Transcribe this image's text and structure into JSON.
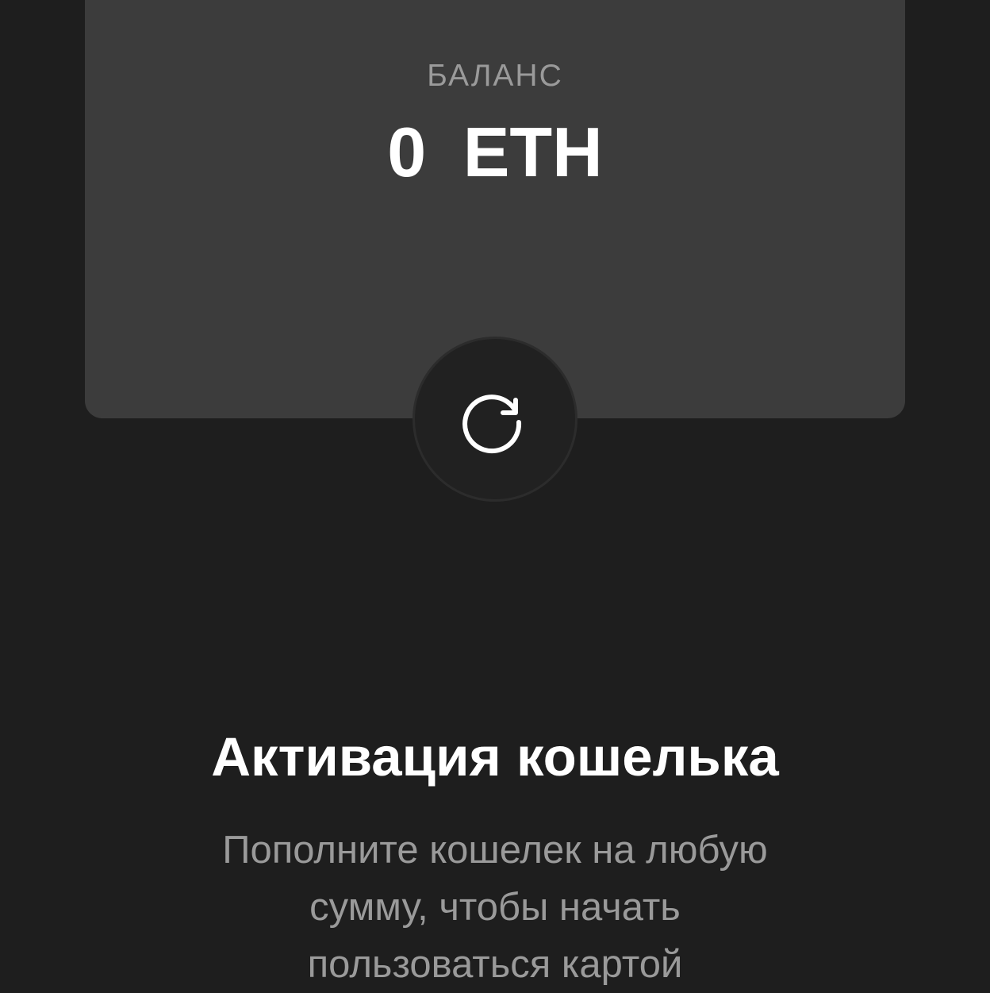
{
  "balance": {
    "label": "БАЛАНС",
    "value": "0 ETH"
  },
  "refresh": {
    "icon": "refresh-icon"
  },
  "activation": {
    "title": "Активация кошелька",
    "description": "Пополните кошелек на любую сумму, чтобы начать пользоваться картой"
  },
  "colors": {
    "background": "#1e1e1e",
    "card": "#3c3c3c",
    "button": "#212121",
    "text_primary": "#ffffff",
    "text_secondary": "#9a9a9a"
  }
}
